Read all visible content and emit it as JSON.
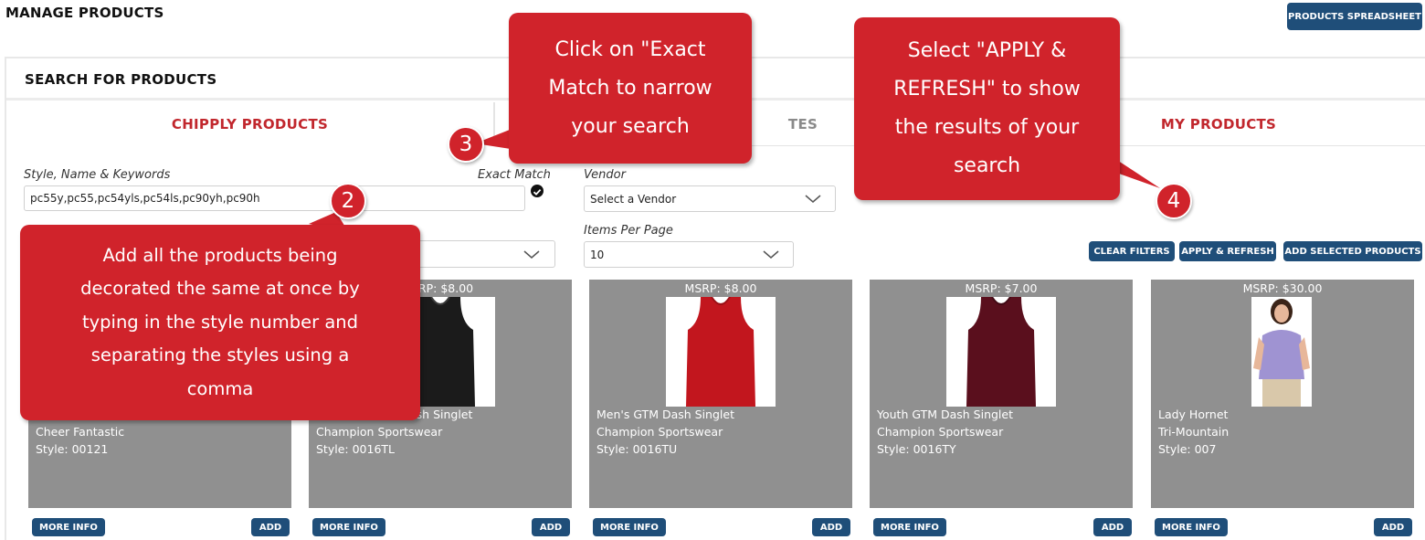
{
  "page": {
    "title": "MANAGE PRODUCTS",
    "spreadsheet_button": "PRODUCTS SPREADSHEET"
  },
  "search": {
    "header": "SEARCH FOR PRODUCTS",
    "tabs": {
      "chipply": "CHIPPLY PRODUCTS",
      "favorites": "TES",
      "my": "MY PRODUCTS"
    },
    "keywords_label": "Style, Name & Keywords",
    "keywords_value": "pc55y,pc55,pc54yls,pc54ls,pc90yh,pc90h",
    "exact_match_label": "Exact Match",
    "vendor_label": "Vendor",
    "vendor_value": "Select a Vendor",
    "items_per_page_label": "Items Per Page",
    "items_per_page_value": "10",
    "clear_filters": "CLEAR FILTERS",
    "apply_refresh": "APPLY & REFRESH",
    "add_selected": "ADD SELECTED PRODUCTS"
  },
  "products": [
    {
      "msrp": "",
      "name": "",
      "vendor": "Cheer Fantastic",
      "style": "Style: 00121",
      "image": "none"
    },
    {
      "msrp": "SRP: $8.00",
      "name": "ash Singlet",
      "vendor": "Champion Sportswear",
      "style": "Style: 0016TL",
      "image": "black-tank",
      "color": "#1b1b1b"
    },
    {
      "msrp": "MSRP: $8.00",
      "name": "Men's GTM Dash Singlet",
      "vendor": "Champion Sportswear",
      "style": "Style: 0016TU",
      "image": "red-tank",
      "color": "#c2161e"
    },
    {
      "msrp": "MSRP: $7.00",
      "name": "Youth GTM Dash Singlet",
      "vendor": "Champion Sportswear",
      "style": "Style: 0016TY",
      "image": "maroon-tank",
      "color": "#5a0f1d"
    },
    {
      "msrp": "MSRP: $30.00",
      "name": "Lady Hornet",
      "vendor": "Tri-Mountain",
      "style": "Style: 007",
      "image": "woman-polo",
      "color": "#9f93d2"
    }
  ],
  "card_actions": {
    "more_info": "MORE INFO",
    "add": "ADD"
  },
  "callouts": {
    "step2": {
      "number": "2",
      "lines": [
        "Add all the products being",
        "decorated the same at once by",
        "typing in the style number and",
        "separating the styles using a",
        "comma"
      ]
    },
    "step3": {
      "number": "3",
      "lines": [
        "Click on \"Exact",
        "Match to narrow",
        "your search"
      ]
    },
    "step4": {
      "number": "4",
      "lines": [
        "Select \"APPLY &",
        "REFRESH\" to show",
        "the results of your",
        "search"
      ]
    }
  },
  "colors": {
    "navy": "#1f4e79",
    "accent_red": "#c1272d",
    "callout_red": "#d0232b",
    "card_gray": "#909090"
  }
}
